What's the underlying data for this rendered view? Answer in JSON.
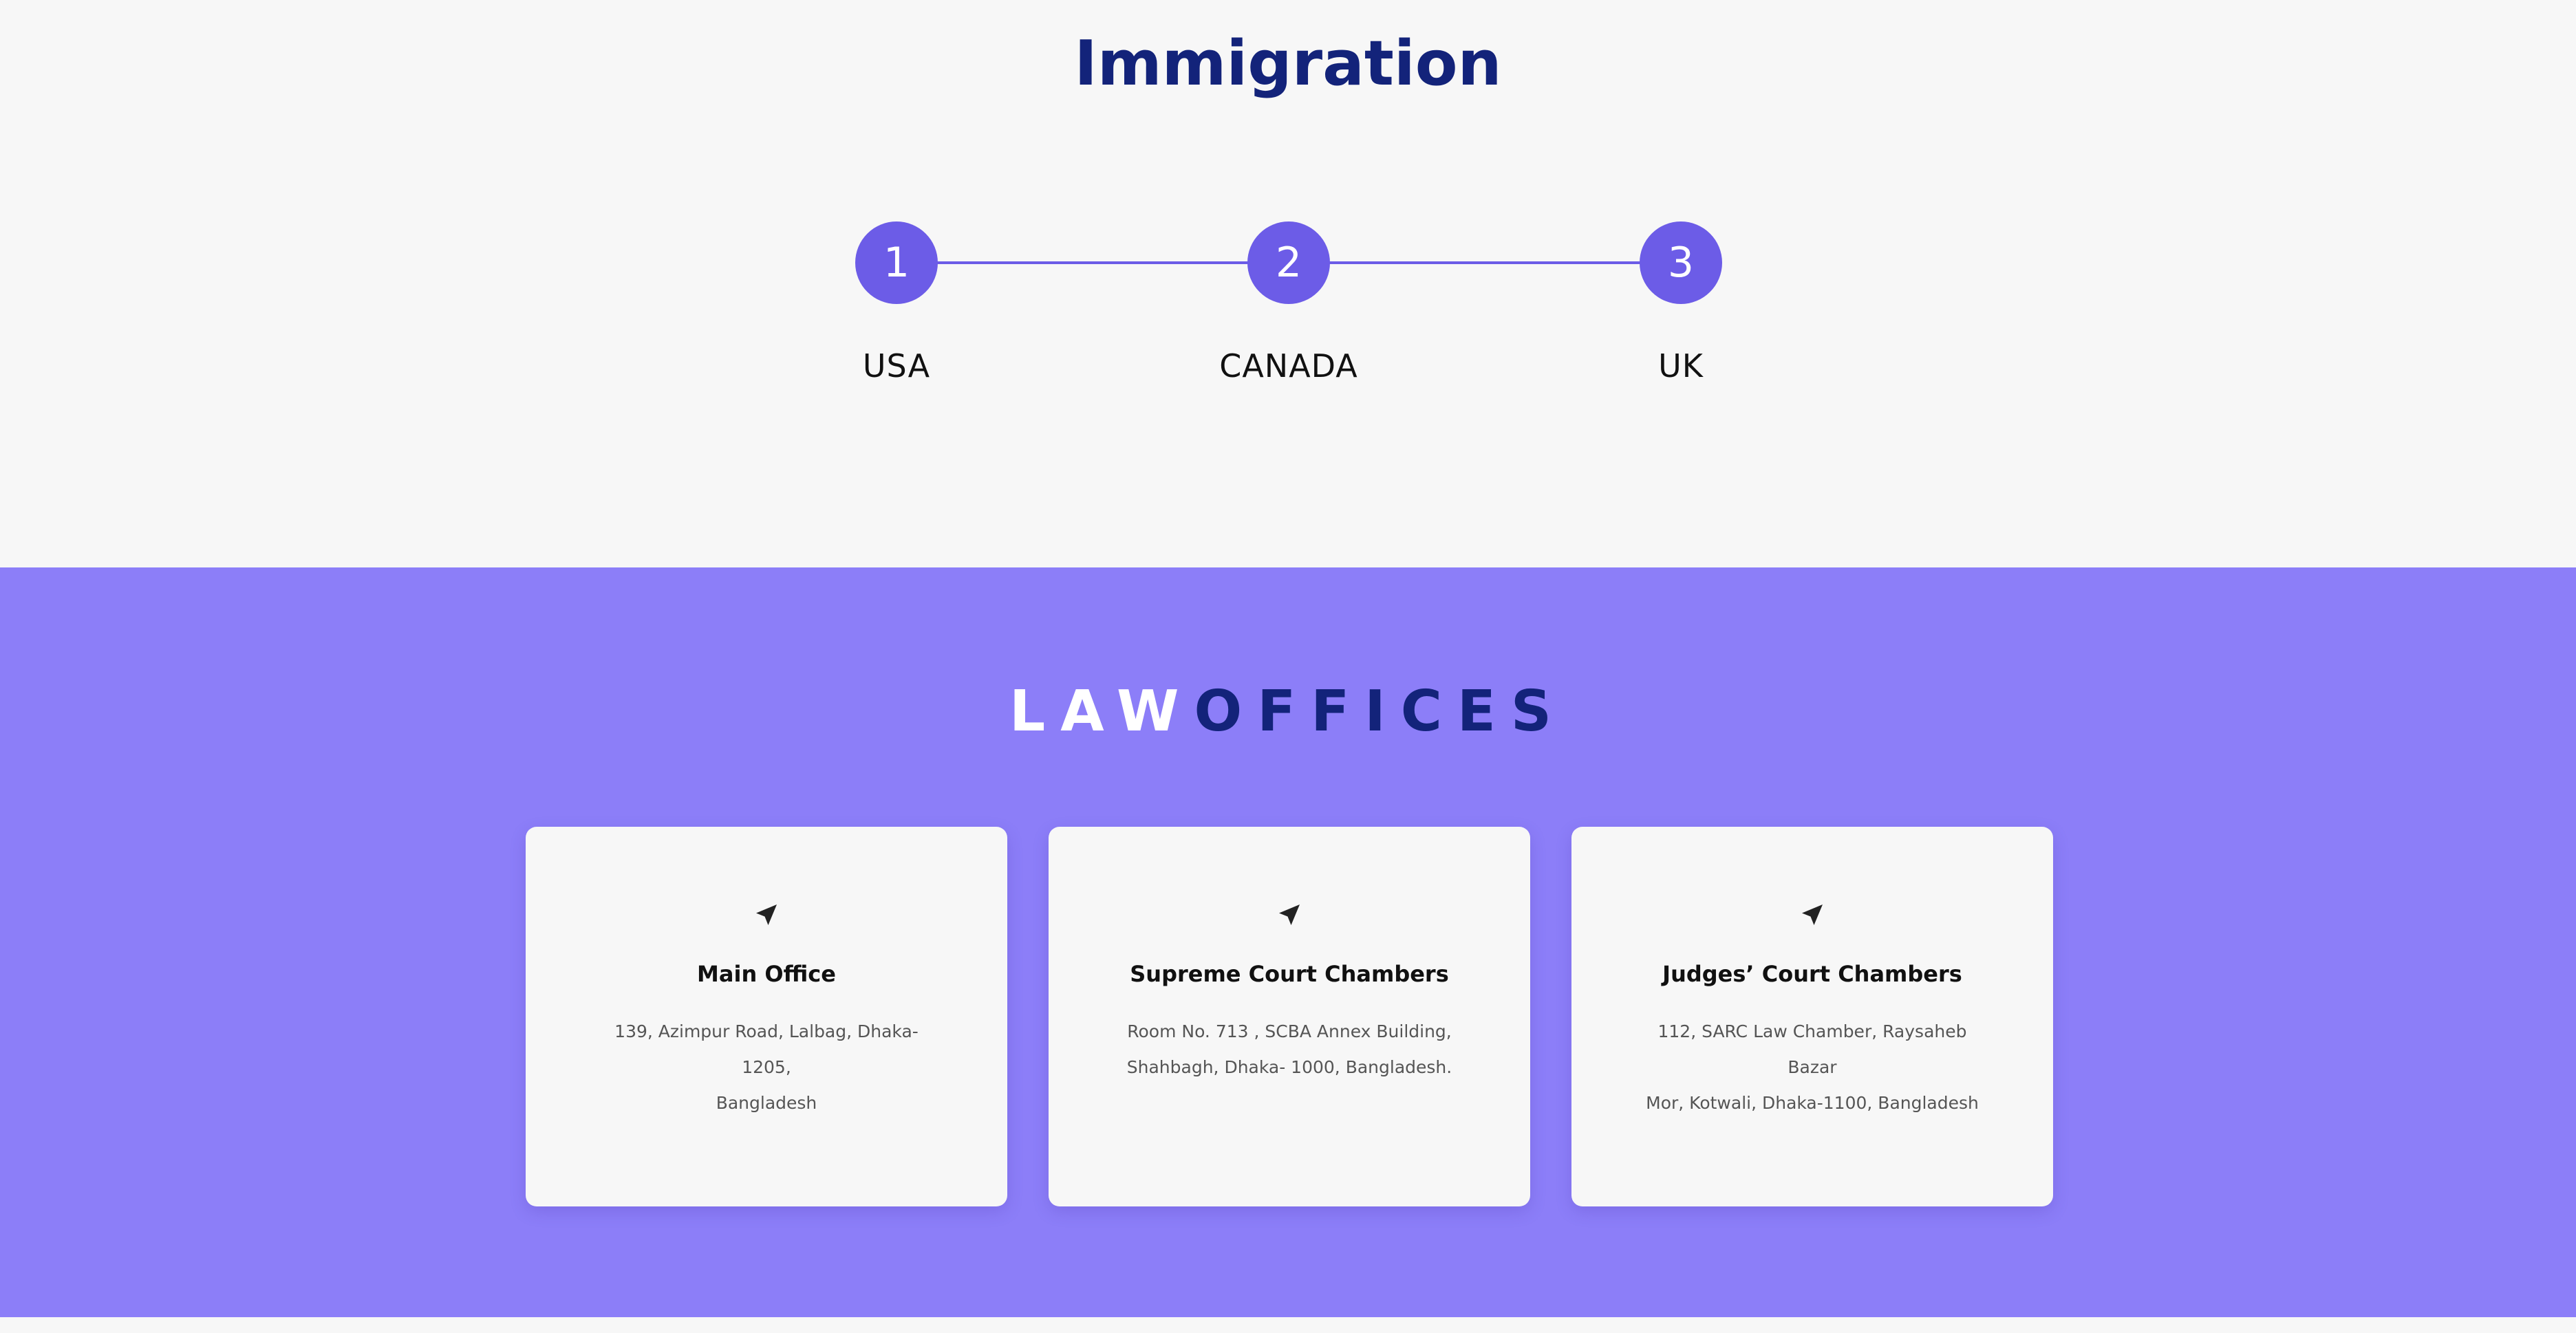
{
  "immigration": {
    "title": "Immigration",
    "steps": [
      {
        "number": "1",
        "label": "USA"
      },
      {
        "number": "2",
        "label": "CANADA"
      },
      {
        "number": "3",
        "label": "UK"
      }
    ]
  },
  "offices": {
    "title_part1": "LAW",
    "title_part2": "OFFICES",
    "cards": [
      {
        "icon": "location-arrow-icon",
        "title": "Main Office",
        "address_line1": "139, Azimpur Road, Lalbag, Dhaka- 1205,",
        "address_line2": "Bangladesh"
      },
      {
        "icon": "location-arrow-icon",
        "title": "Supreme Court Chambers",
        "address_line1": "Room No. 713 , SCBA Annex Building,",
        "address_line2": "Shahbagh, Dhaka- 1000, Bangladesh."
      },
      {
        "icon": "location-arrow-icon",
        "title": "Judges’ Court Chambers",
        "address_line1": "112, SARC Law Chamber, Raysaheb Bazar",
        "address_line2": "Mor, Kotwali, Dhaka-1100, Bangladesh"
      }
    ]
  },
  "colors": {
    "accent": "#6c5ce7",
    "offices_background": "#8c7ef8",
    "title_navy": "#13237a",
    "page_background": "#f7f7f7"
  }
}
